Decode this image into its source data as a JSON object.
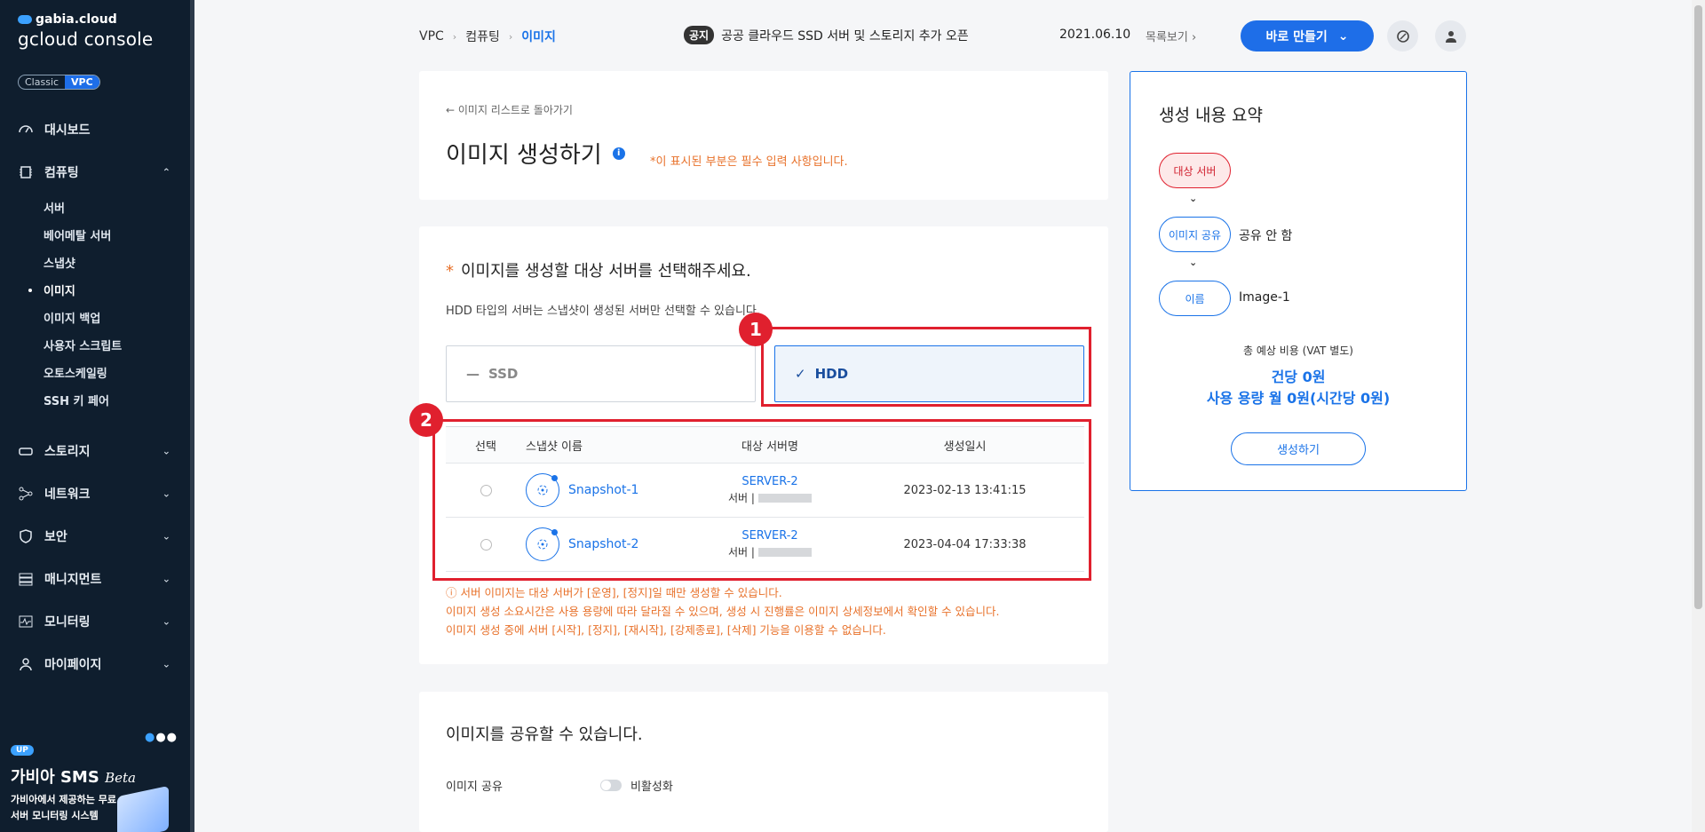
{
  "sidebar": {
    "brand_top": "gabia.cloud",
    "brand_console": "gcloud console",
    "toggle": {
      "classic": "Classic",
      "vpc": "VPC"
    },
    "items": [
      {
        "label": "대시보드"
      },
      {
        "label": "컴퓨팅"
      },
      {
        "label": "스토리지"
      },
      {
        "label": "네트워크"
      },
      {
        "label": "보안"
      },
      {
        "label": "매니지먼트"
      },
      {
        "label": "모니터링"
      },
      {
        "label": "마이페이지"
      }
    ],
    "sub_items": [
      {
        "label": "서버"
      },
      {
        "label": "베어메탈 서버"
      },
      {
        "label": "스냅샷"
      },
      {
        "label": "이미지"
      },
      {
        "label": "이미지 백업"
      },
      {
        "label": "사용자 스크립트"
      },
      {
        "label": "오토스케일링"
      },
      {
        "label": "SSH 키 페어"
      }
    ],
    "promo": {
      "badge": "UP",
      "title": "가비아 SMS",
      "title_suffix": "Beta",
      "desc": "가비아에서 제공하는 무료 서버 모니터링 시스템"
    }
  },
  "header": {
    "breadcrumb": [
      "VPC",
      "컴퓨팅",
      "이미지"
    ],
    "notice_tag": "공지",
    "notice_text": "공공 클라우드 SSD 서버 및 스토리지 추가 오픈",
    "notice_date": "2021.06.10",
    "notice_more": "목록보기",
    "create_button": "바로 만들기"
  },
  "main": {
    "back_link": "이미지 리스트로 돌아가기",
    "title": "이미지 생성하기",
    "required_note": "*이 표시된 부분은 필수 입력 사항입니다.",
    "section_title": "이미지를 생성할 대상 서버를 선택해주세요.",
    "section_star": "*",
    "section_desc": "HDD 타입의 서버는 스냅샷이 생성된 서버만 선택할 수 있습니다.",
    "type_ssd": "SSD",
    "type_hdd": "HDD",
    "annotations": [
      "1",
      "2"
    ],
    "table": {
      "headers": [
        "선택",
        "스냅샷 이름",
        "대상 서버명",
        "생성일시"
      ],
      "rows": [
        {
          "name": "Snapshot-1",
          "server": "SERVER-2",
          "server_sub": "서버 |",
          "date": "2023-02-13 13:41:15"
        },
        {
          "name": "Snapshot-2",
          "server": "SERVER-2",
          "server_sub": "서버 |",
          "date": "2023-04-04 17:33:38"
        }
      ]
    },
    "warnings": [
      "ⓘ 서버 이미지는 대상 서버가 [운영], [정지]일 때만 생성할 수 있습니다.",
      "이미지 생성 소요시간은 사용 용량에 따라 달라질 수 있으며, 생성 시 진행률은 이미지 상세정보에서 확인할 수 있습니다.",
      "이미지 생성 중에 서버 [시작], [정지], [재시작], [강제종료], [삭제] 기능을 이용할 수 없습니다."
    ],
    "share_title": "이미지를 공유할 수 있습니다.",
    "share_label": "이미지 공유",
    "share_state": "비활성화"
  },
  "summary": {
    "title": "생성 내용 요약",
    "rows": [
      {
        "pill": "대상 서버",
        "value": ""
      },
      {
        "pill": "이미지 공유",
        "value": "공유 안 함"
      },
      {
        "pill": "이름",
        "value": "Image-1"
      }
    ],
    "cost_label": "총 예상 비용 (VAT 별도)",
    "cost_line1": "건당 0원",
    "cost_line2": "사용 용량 월 0원(시간당 0원)",
    "button": "생성하기"
  },
  "colors": {
    "primary": "#1e6ee8",
    "highlight": "#e0202e",
    "warning": "#e8712a",
    "sidebar_bg": "#0f1e2e"
  }
}
